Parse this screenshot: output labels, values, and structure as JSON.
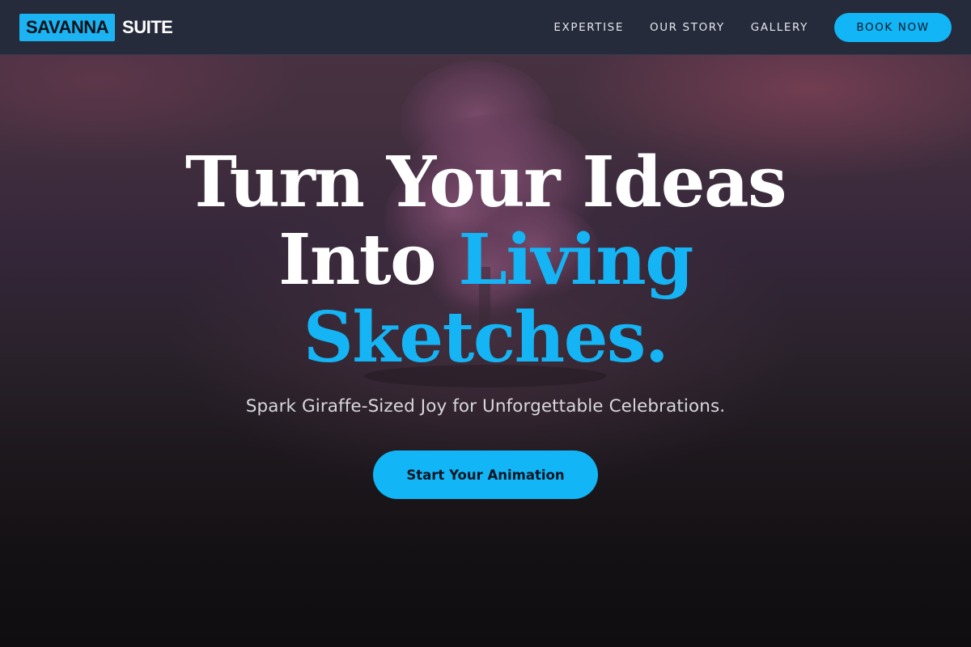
{
  "brand": {
    "logo_box_text": "SAVANNA",
    "logo_text": "SUITE",
    "accent_color": "#14b4f5"
  },
  "nav": {
    "items": [
      {
        "label": "EXPERTISE"
      },
      {
        "label": "OUR STORY"
      },
      {
        "label": "GALLERY"
      }
    ],
    "cta_label": "BOOK NOW"
  },
  "hero": {
    "headline_line1": "Turn Your Ideas",
    "headline_line2_plain": "Into",
    "headline_line2_accent": "Living",
    "headline_line3_accent": "Sketches.",
    "subtitle": "Spark Giraffe-Sized Joy for Unforgettable Celebrations.",
    "cta_label": "Start Your Animation"
  }
}
